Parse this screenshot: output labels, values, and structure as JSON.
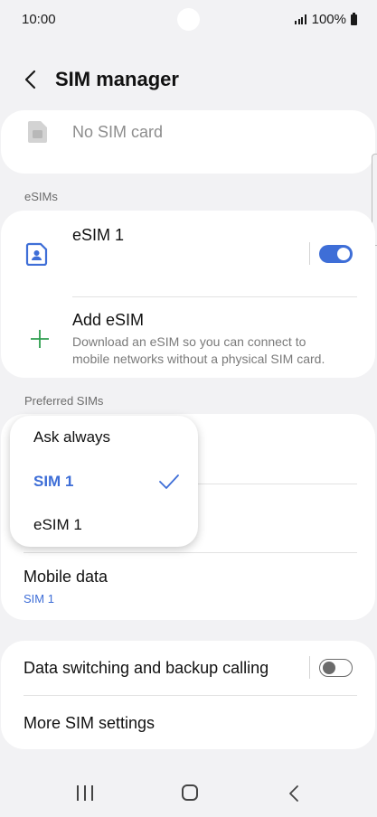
{
  "status_bar": {
    "time": "10:00",
    "battery": "100%"
  },
  "header": {
    "title": "SIM manager"
  },
  "physical_sim": {
    "label": "No SIM card"
  },
  "esims": {
    "section_label": "eSIMs",
    "esim1_name": "eSIM 1",
    "esim1_enabled": true,
    "add_title": "Add eSIM",
    "add_description": "Download an eSIM so you can connect to mobile networks without a physical SIM card."
  },
  "preferred_sims": {
    "section_label": "Preferred SIMs",
    "mobile_data_label": "Mobile data",
    "mobile_data_value": "SIM 1"
  },
  "popup_menu": {
    "options": [
      "Ask always",
      "SIM 1",
      "eSIM 1"
    ],
    "selected": "SIM 1"
  },
  "more": {
    "data_switching_label": "Data switching and backup calling",
    "data_switching_enabled": false,
    "more_settings_label": "More SIM settings"
  },
  "colors": {
    "accent": "#3e6ed7",
    "background": "#f2f2f4",
    "plus": "#2e9e4f"
  }
}
